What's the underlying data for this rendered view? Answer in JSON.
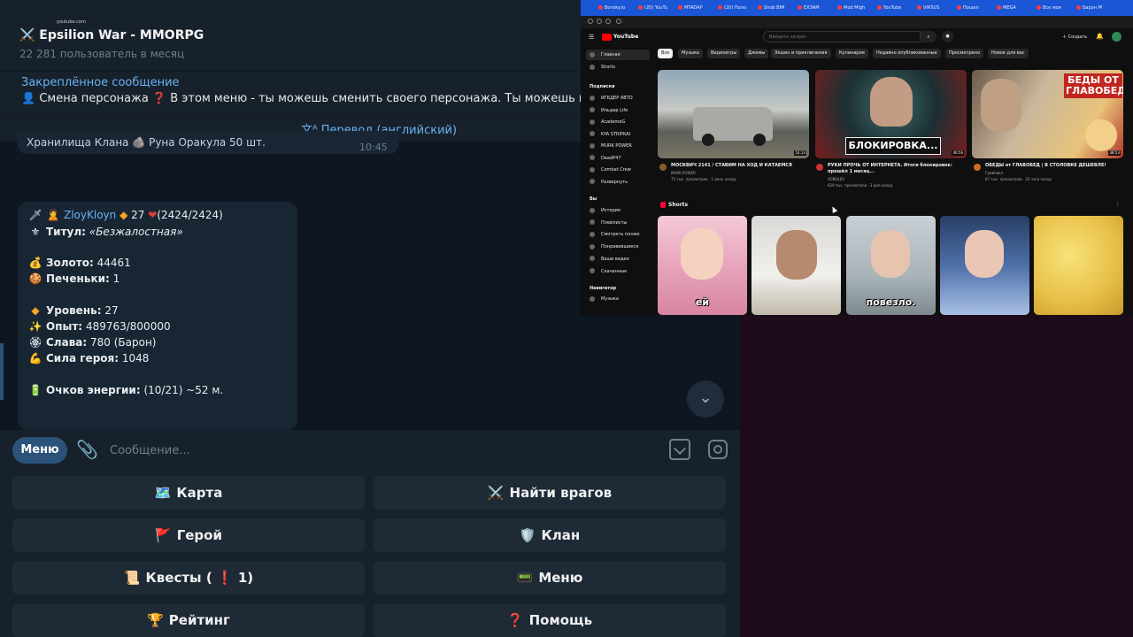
{
  "telegram": {
    "chat_title": "⚔️ Epsilion War - MMORPG",
    "chat_subtitle": "22 281 пользователь в месяц",
    "pinned_title": "Закреплённое сообщение",
    "pinned_text": "👤 Смена персонажа ❓ В этом меню - ты можешь сменить своего персонажа. Ты можешь иметь до",
    "translate_label": "Перевод (английский)",
    "previous_message_text": "Хранилища Клана 🪨 Руна Оракула 50 шт.",
    "previous_message_time": "10:45",
    "profile": {
      "name": "ZloyKloyn",
      "level_badge": "27",
      "hp": "(2424/2424)",
      "title_label": "Титул:",
      "title_value": "«Безжалостная»",
      "gold_label": "Золото:",
      "gold_value": "44461",
      "cookies_label": "Печеньки:",
      "cookies_value": "1",
      "level_label": "Уровень:",
      "level_value": "27",
      "exp_label": "Опыт:",
      "exp_value": "489763/800000",
      "glory_label": "Слава:",
      "glory_value": "780 (Барон)",
      "power_label": "Сила героя:",
      "power_value": "1048",
      "energy_label": "Очков энергии:",
      "energy_value": "(10/21) ~52 м."
    },
    "menu_button": "Меню",
    "message_placeholder": "Сообщение...",
    "keyboard": [
      {
        "icon": "🗺️",
        "label": "Карта"
      },
      {
        "icon": "⚔️",
        "label": "Найти врагов"
      },
      {
        "icon": "🚩",
        "label": "Герой"
      },
      {
        "icon": "🛡️",
        "label": "Клан"
      },
      {
        "icon": "📜",
        "label": "Квесты ( ❗ 1)"
      },
      {
        "icon": "📟",
        "label": "Меню"
      },
      {
        "icon": "🏆",
        "label": "Рейтинг"
      },
      {
        "icon": "❓",
        "label": "Помощь"
      }
    ]
  },
  "browser": {
    "tabs": [
      "Bonsky.io",
      "(20) YouTu",
      "MTADAP",
      "(20) Поло",
      "Snob BIM",
      "ЕХЗАМ",
      "Mod Migh",
      "YouTube",
      "VIRSUS",
      "Пошел",
      "MEGA",
      "Все мои",
      "Барон М"
    ],
    "url": "youtube.com",
    "search_placeholder": "Введите запрос",
    "create_label": "Создать",
    "logo_text": "YouTube",
    "chips": [
      "Все",
      "Музыка",
      "Видеоигры",
      "Джемы",
      "Экшен и приключения",
      "Кулинария",
      "Недавно опубликованные",
      "Просмотрено",
      "Новое для вас"
    ],
    "sidebar": {
      "main": [
        "Главная",
        "Shorts"
      ],
      "subs_header": "Подписки",
      "subs": [
        "ИГБДЕР АВТО",
        "Ильдар Life",
        "AcademeG",
        "KYA STRIPKAI",
        "MURK POWER",
        "DeadP47",
        "Combat Crew",
        "Развернуть"
      ],
      "you_header": "Вы",
      "you": [
        "История",
        "Плейлисты",
        "Смотреть позже",
        "Понравившиеся",
        "Ваши видео",
        "Скачанные"
      ],
      "nav_header": "Навигатор",
      "nav": [
        "Музыка"
      ]
    },
    "videos": [
      {
        "title": "МОСКВИЧ 2141 / СТАВИМ НА ХОД И КАТАЕМСЯ",
        "channel": "MURK POWER",
        "meta": "75 тыс. просмотров · 1 день назад",
        "duration": "52:13",
        "avatar_color": "#8b5a2b"
      },
      {
        "title": "РУКИ ПРОЧЬ ОТ ИНТЕРНЕТА. Итоги блокировок: прошёл 1 месяц...",
        "channel": "SOBOLEV",
        "meta": "629 тыс. просмотров · 3 дня назад",
        "duration": "40:56",
        "thumb_text": "БЛОКИРОВКА...",
        "avatar_color": "#cc3333"
      },
      {
        "title": "ОБЕДЫ от ГЛАВОБЕД | В СТОЛОВКЕ ДЕШЕВЛЕ!",
        "channel": "Грейпвол",
        "meta": "87 тыс. просмотров · 22 часа назад",
        "duration": "38:53",
        "thumb_text": "БЕДЫ ОТ ГЛАВОБЕД",
        "avatar_color": "#d4691e"
      }
    ],
    "shorts_header": "Shorts",
    "shorts": [
      {
        "caption": "ей"
      },
      {
        "caption": ""
      },
      {
        "caption": "повезло."
      },
      {
        "caption": ""
      },
      {
        "caption": ""
      }
    ]
  }
}
